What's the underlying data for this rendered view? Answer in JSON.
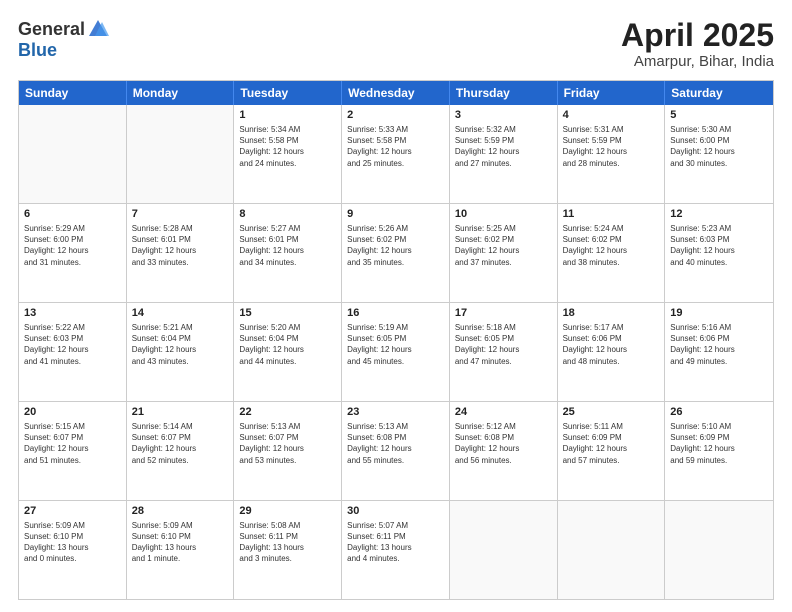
{
  "header": {
    "logo_general": "General",
    "logo_blue": "Blue",
    "title": "April 2025",
    "location": "Amarpur, Bihar, India"
  },
  "days_of_week": [
    "Sunday",
    "Monday",
    "Tuesday",
    "Wednesday",
    "Thursday",
    "Friday",
    "Saturday"
  ],
  "weeks": [
    [
      {
        "day": "",
        "info": ""
      },
      {
        "day": "",
        "info": ""
      },
      {
        "day": "1",
        "info": "Sunrise: 5:34 AM\nSunset: 5:58 PM\nDaylight: 12 hours\nand 24 minutes."
      },
      {
        "day": "2",
        "info": "Sunrise: 5:33 AM\nSunset: 5:58 PM\nDaylight: 12 hours\nand 25 minutes."
      },
      {
        "day": "3",
        "info": "Sunrise: 5:32 AM\nSunset: 5:59 PM\nDaylight: 12 hours\nand 27 minutes."
      },
      {
        "day": "4",
        "info": "Sunrise: 5:31 AM\nSunset: 5:59 PM\nDaylight: 12 hours\nand 28 minutes."
      },
      {
        "day": "5",
        "info": "Sunrise: 5:30 AM\nSunset: 6:00 PM\nDaylight: 12 hours\nand 30 minutes."
      }
    ],
    [
      {
        "day": "6",
        "info": "Sunrise: 5:29 AM\nSunset: 6:00 PM\nDaylight: 12 hours\nand 31 minutes."
      },
      {
        "day": "7",
        "info": "Sunrise: 5:28 AM\nSunset: 6:01 PM\nDaylight: 12 hours\nand 33 minutes."
      },
      {
        "day": "8",
        "info": "Sunrise: 5:27 AM\nSunset: 6:01 PM\nDaylight: 12 hours\nand 34 minutes."
      },
      {
        "day": "9",
        "info": "Sunrise: 5:26 AM\nSunset: 6:02 PM\nDaylight: 12 hours\nand 35 minutes."
      },
      {
        "day": "10",
        "info": "Sunrise: 5:25 AM\nSunset: 6:02 PM\nDaylight: 12 hours\nand 37 minutes."
      },
      {
        "day": "11",
        "info": "Sunrise: 5:24 AM\nSunset: 6:02 PM\nDaylight: 12 hours\nand 38 minutes."
      },
      {
        "day": "12",
        "info": "Sunrise: 5:23 AM\nSunset: 6:03 PM\nDaylight: 12 hours\nand 40 minutes."
      }
    ],
    [
      {
        "day": "13",
        "info": "Sunrise: 5:22 AM\nSunset: 6:03 PM\nDaylight: 12 hours\nand 41 minutes."
      },
      {
        "day": "14",
        "info": "Sunrise: 5:21 AM\nSunset: 6:04 PM\nDaylight: 12 hours\nand 43 minutes."
      },
      {
        "day": "15",
        "info": "Sunrise: 5:20 AM\nSunset: 6:04 PM\nDaylight: 12 hours\nand 44 minutes."
      },
      {
        "day": "16",
        "info": "Sunrise: 5:19 AM\nSunset: 6:05 PM\nDaylight: 12 hours\nand 45 minutes."
      },
      {
        "day": "17",
        "info": "Sunrise: 5:18 AM\nSunset: 6:05 PM\nDaylight: 12 hours\nand 47 minutes."
      },
      {
        "day": "18",
        "info": "Sunrise: 5:17 AM\nSunset: 6:06 PM\nDaylight: 12 hours\nand 48 minutes."
      },
      {
        "day": "19",
        "info": "Sunrise: 5:16 AM\nSunset: 6:06 PM\nDaylight: 12 hours\nand 49 minutes."
      }
    ],
    [
      {
        "day": "20",
        "info": "Sunrise: 5:15 AM\nSunset: 6:07 PM\nDaylight: 12 hours\nand 51 minutes."
      },
      {
        "day": "21",
        "info": "Sunrise: 5:14 AM\nSunset: 6:07 PM\nDaylight: 12 hours\nand 52 minutes."
      },
      {
        "day": "22",
        "info": "Sunrise: 5:13 AM\nSunset: 6:07 PM\nDaylight: 12 hours\nand 53 minutes."
      },
      {
        "day": "23",
        "info": "Sunrise: 5:13 AM\nSunset: 6:08 PM\nDaylight: 12 hours\nand 55 minutes."
      },
      {
        "day": "24",
        "info": "Sunrise: 5:12 AM\nSunset: 6:08 PM\nDaylight: 12 hours\nand 56 minutes."
      },
      {
        "day": "25",
        "info": "Sunrise: 5:11 AM\nSunset: 6:09 PM\nDaylight: 12 hours\nand 57 minutes."
      },
      {
        "day": "26",
        "info": "Sunrise: 5:10 AM\nSunset: 6:09 PM\nDaylight: 12 hours\nand 59 minutes."
      }
    ],
    [
      {
        "day": "27",
        "info": "Sunrise: 5:09 AM\nSunset: 6:10 PM\nDaylight: 13 hours\nand 0 minutes."
      },
      {
        "day": "28",
        "info": "Sunrise: 5:09 AM\nSunset: 6:10 PM\nDaylight: 13 hours\nand 1 minute."
      },
      {
        "day": "29",
        "info": "Sunrise: 5:08 AM\nSunset: 6:11 PM\nDaylight: 13 hours\nand 3 minutes."
      },
      {
        "day": "30",
        "info": "Sunrise: 5:07 AM\nSunset: 6:11 PM\nDaylight: 13 hours\nand 4 minutes."
      },
      {
        "day": "",
        "info": ""
      },
      {
        "day": "",
        "info": ""
      },
      {
        "day": "",
        "info": ""
      }
    ]
  ]
}
